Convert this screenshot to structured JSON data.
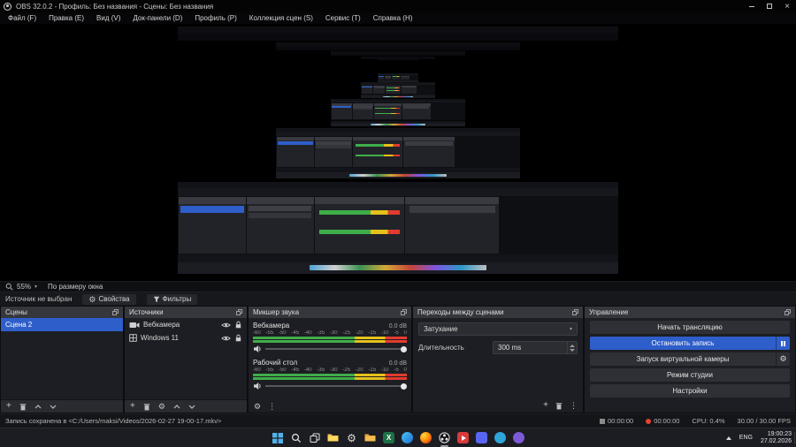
{
  "window": {
    "title": "OBS 32.0.2 - Профиль: Без названия - Сцены: Без названия"
  },
  "menu": {
    "items": [
      {
        "label": "Файл (F)"
      },
      {
        "label": "Правка (E)"
      },
      {
        "label": "Вид (V)"
      },
      {
        "label": "Док-панели (D)"
      },
      {
        "label": "Профиль (P)"
      },
      {
        "label": "Коллекция сцен (S)"
      },
      {
        "label": "Сервис (T)"
      },
      {
        "label": "Справка (H)"
      }
    ]
  },
  "preview_bar": {
    "zoom": "55%",
    "fit": "По размеру окна"
  },
  "source_bar": {
    "status": "Источник не выбран",
    "properties": "Свойства",
    "filters": "Фильтры"
  },
  "scenes": {
    "title": "Сцены",
    "items": [
      {
        "label": "Сцена 2",
        "selected": true
      }
    ]
  },
  "sources": {
    "title": "Источники",
    "items": [
      {
        "label": "Вебкамера",
        "icon": "camera-icon",
        "visible": true,
        "locked": false
      },
      {
        "label": "Windows 11",
        "icon": "window-icon",
        "visible": true,
        "locked": false
      }
    ]
  },
  "mixer": {
    "title": "Микшер звука",
    "channels": [
      {
        "name": "Вебкамера",
        "level": "0.0 dB"
      },
      {
        "name": "Рабочий стол",
        "level": "0.0 dB"
      }
    ],
    "ticks": [
      "-60",
      "-55",
      "-50",
      "-45",
      "-40",
      "-35",
      "-30",
      "-25",
      "-20",
      "-15",
      "-10",
      "-5",
      "0"
    ]
  },
  "transitions": {
    "title": "Переходы между сценами",
    "current": "Затухание",
    "duration_label": "Длительность",
    "duration": "300 ms"
  },
  "controls": {
    "title": "Управление",
    "start_stream": "Начать трансляцию",
    "stop_record": "Остановить запись",
    "virtual_cam": "Запуск виртуальной камеры",
    "studio_mode": "Режим студии",
    "settings": "Настройки"
  },
  "status": {
    "message": "Запись сохранена в <C:/Users/maksi/Videos/2026-02-27 19-00-17.mkv>",
    "stream_time": "00:00:00",
    "record_time": "00:00:00",
    "cpu": "CPU: 0.4%",
    "fps": "30.00 / 30.00 FPS"
  },
  "taskbar": {
    "language": "ENG",
    "time": "19:00:23",
    "date": "27.02.2026"
  },
  "colors": {
    "accent_blue": "#2e5ec9",
    "record_red": "#e34234",
    "meter_green": "#3fae49",
    "meter_yellow": "#e5c11b",
    "meter_red": "#e23b2e"
  }
}
